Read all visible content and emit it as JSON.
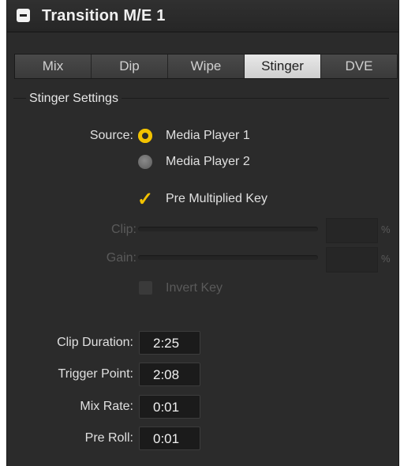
{
  "header": {
    "title": "Transition M/E 1"
  },
  "tabs": [
    {
      "label": "Mix"
    },
    {
      "label": "Dip"
    },
    {
      "label": "Wipe"
    },
    {
      "label": "Stinger",
      "active": true
    },
    {
      "label": "DVE"
    }
  ],
  "settings": {
    "section_title": "Stinger Settings",
    "source_label": "Source:",
    "source_options": [
      {
        "label": "Media Player 1",
        "selected": true
      },
      {
        "label": "Media Player 2",
        "selected": false
      }
    ],
    "pre_multiplied_key": {
      "label": "Pre Multiplied Key",
      "checked": true
    },
    "clip": {
      "label": "Clip:",
      "unit": "%",
      "enabled": false
    },
    "gain": {
      "label": "Gain:",
      "unit": "%",
      "enabled": false
    },
    "invert_key": {
      "label": "Invert Key",
      "checked": false,
      "enabled": false
    }
  },
  "timing": {
    "clip_duration": {
      "label": "Clip Duration:",
      "value": "2:25"
    },
    "trigger_point": {
      "label": "Trigger Point:",
      "value": "2:08"
    },
    "mix_rate": {
      "label": "Mix Rate:",
      "value": "0:01"
    },
    "pre_roll": {
      "label": "Pre Roll:",
      "value": "0:01"
    }
  },
  "colors": {
    "accent": "#f2c200",
    "panel": "#2b2b2b",
    "field": "#1b1b1b"
  }
}
